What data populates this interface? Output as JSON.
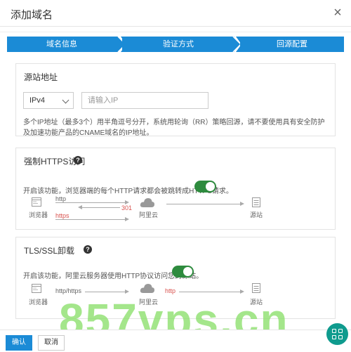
{
  "dialog": {
    "title": "添加域名",
    "close_label": "×"
  },
  "steps": [
    {
      "label": "域名信息"
    },
    {
      "label": "验证方式"
    },
    {
      "label": "回源配置"
    }
  ],
  "origin": {
    "title": "源站地址",
    "ip_type": "IPv4",
    "ip_placeholder": "请输入IP",
    "help": "多个IP地址（最多3个）用半角逗号分开，系统用轮询（RR）策略回源，请不要使用具有安全防护及加速功能产品的CNAME域名的IP地址。"
  },
  "https": {
    "title": "强制HTTPS访问",
    "description": "开启该功能，浏览器端的每个HTTP请求都会被跳转成HTTPS请求。",
    "enabled": true,
    "browser_label": "浏览器",
    "cloud_label": "阿里云",
    "origin_label": "源站",
    "http_label": "http",
    "redirect_label": "301",
    "https_label": "https"
  },
  "tls": {
    "title": "TLS/SSL卸载",
    "description": "开启该功能，阿里云服务器使用HTTP协议访问您的源站。",
    "enabled": true,
    "browser_label": "浏览器",
    "cloud_label": "阿里云",
    "origin_label": "源站",
    "left_label": "http/https",
    "right_label": "http"
  },
  "footer": {
    "confirm_label": "确认",
    "cancel_label": "取消"
  },
  "watermark": "857vps.cn",
  "colors": {
    "accent": "#1b8bd6",
    "toggle_on": "#2e8b3e",
    "redirect": "#d9534f",
    "fab": "#0f9b8e"
  },
  "icons": [
    "close-icon",
    "chevron-down-icon",
    "help-icon",
    "browser-icon",
    "cloud-icon",
    "server-icon",
    "apps-icon"
  ]
}
